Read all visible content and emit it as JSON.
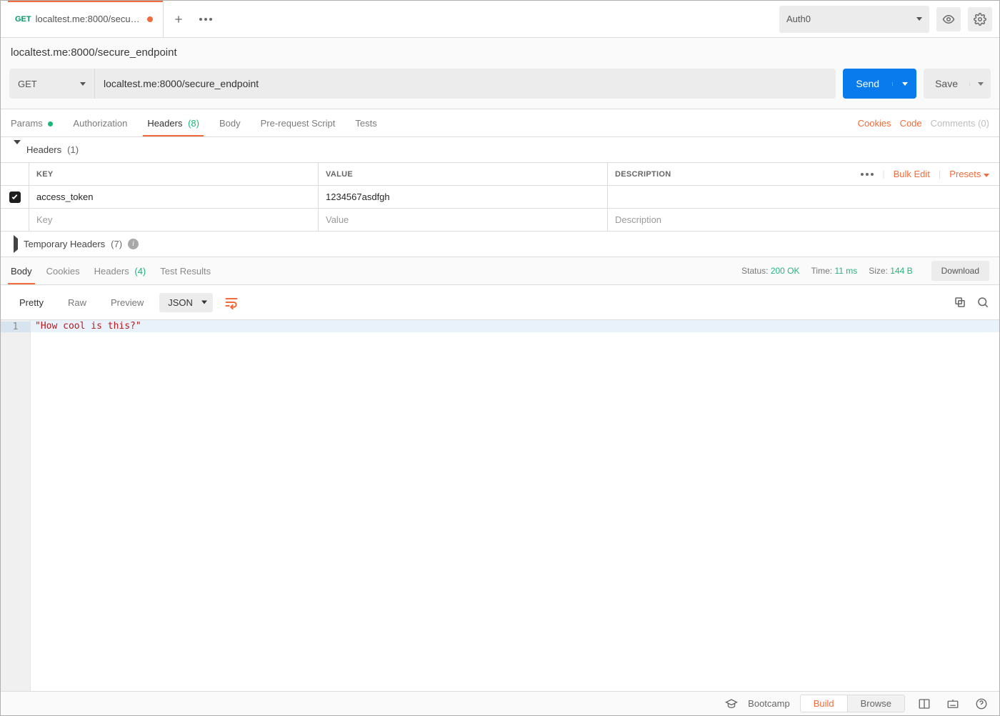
{
  "tab": {
    "method": "GET",
    "title": "localtest.me:8000/secure_endpo"
  },
  "env": {
    "selected": "Auth0"
  },
  "titleRow": "localtest.me:8000/secure_endpoint",
  "url": {
    "method": "GET",
    "value": "localtest.me:8000/secure_endpoint",
    "send": "Send",
    "save": "Save"
  },
  "reqTabs": {
    "params": "Params",
    "authorization": "Authorization",
    "headers": "Headers",
    "headers_count": "(8)",
    "body": "Body",
    "prerequest": "Pre-request Script",
    "tests": "Tests",
    "cookies": "Cookies",
    "code": "Code",
    "comments": "Comments (0)"
  },
  "headersSection": {
    "label": "Headers",
    "count": "(1)"
  },
  "tempHeaders": {
    "label": "Temporary Headers",
    "count": "(7)"
  },
  "headerTable": {
    "cols": {
      "key": "KEY",
      "value": "VALUE",
      "desc": "DESCRIPTION"
    },
    "actions": {
      "bulk": "Bulk Edit",
      "presets": "Presets"
    },
    "rows": [
      {
        "checked": true,
        "key": "access_token",
        "value": "1234567asdfgh",
        "desc": ""
      }
    ],
    "placeholders": {
      "key": "Key",
      "value": "Value",
      "desc": "Description"
    }
  },
  "respTabs": {
    "body": "Body",
    "cookies": "Cookies",
    "headers": "Headers",
    "headers_count": "(4)",
    "tests": "Test Results"
  },
  "respMeta": {
    "status_label": "Status:",
    "status_value": "200 OK",
    "time_label": "Time:",
    "time_value": "11 ms",
    "size_label": "Size:",
    "size_value": "144 B",
    "download": "Download"
  },
  "respToolbar": {
    "pretty": "Pretty",
    "raw": "Raw",
    "preview": "Preview",
    "format": "JSON"
  },
  "codeBody": {
    "line1_num": "1",
    "line1": "\"How cool is this?\""
  },
  "bottom": {
    "bootcamp": "Bootcamp",
    "build": "Build",
    "browse": "Browse"
  }
}
